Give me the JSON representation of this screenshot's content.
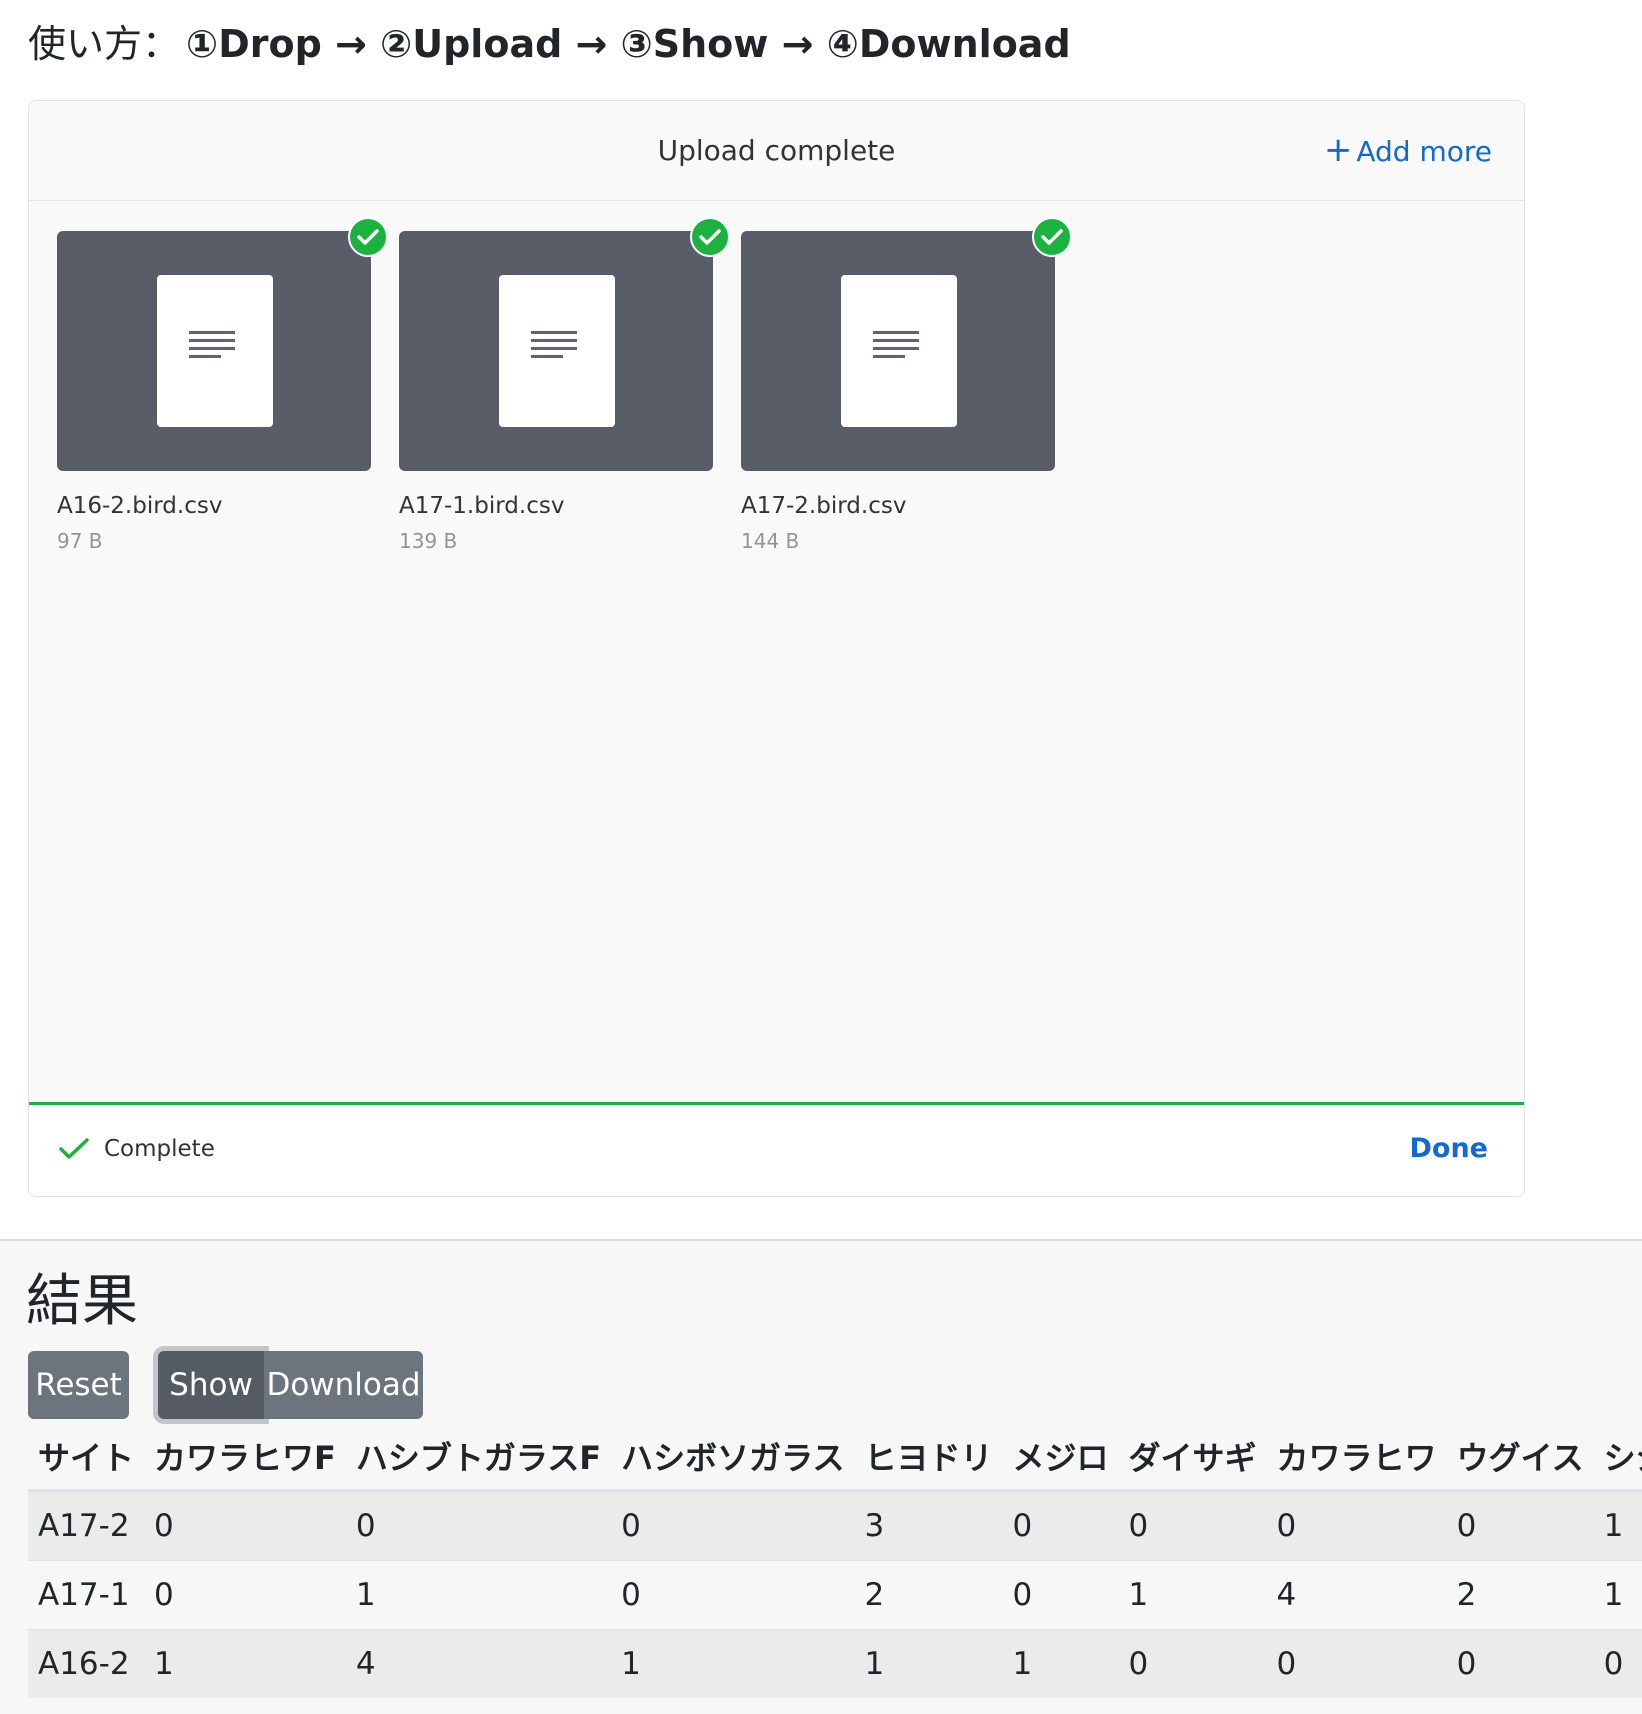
{
  "howto": {
    "label": "使い方：",
    "steps": "①Drop → ②Upload → ③Show → ④Download"
  },
  "dashboard": {
    "title": "Upload complete",
    "add_more": "Add more",
    "files": [
      {
        "name": "A16-2.bird.csv",
        "size": "97 B"
      },
      {
        "name": "A17-1.bird.csv",
        "size": "139 B"
      },
      {
        "name": "A17-2.bird.csv",
        "size": "144 B"
      }
    ],
    "status": "Complete",
    "done": "Done",
    "progress_percent": 100
  },
  "results": {
    "heading": "結果",
    "buttons": {
      "reset": "Reset",
      "show": "Show",
      "download": "Download"
    },
    "columns": [
      "サイト",
      "カワラヒワF",
      "ハシブトガラスF",
      "ハシボソガラス",
      "ヒヨドリ",
      "メジロ",
      "ダイサギ",
      "カワラヒワ",
      "ウグイス",
      "シジ"
    ],
    "rows": [
      [
        "A17-2",
        "0",
        "0",
        "0",
        "3",
        "0",
        "0",
        "0",
        "0",
        "1"
      ],
      [
        "A17-1",
        "0",
        "1",
        "0",
        "2",
        "0",
        "1",
        "4",
        "2",
        "1"
      ],
      [
        "A16-2",
        "1",
        "4",
        "1",
        "1",
        "1",
        "0",
        "0",
        "0",
        "0"
      ]
    ]
  },
  "colors": {
    "accent_blue": "#1269cf",
    "success_green": "#1bb240",
    "button_gray": "#6c757d",
    "thumb_gray": "#585d68"
  }
}
